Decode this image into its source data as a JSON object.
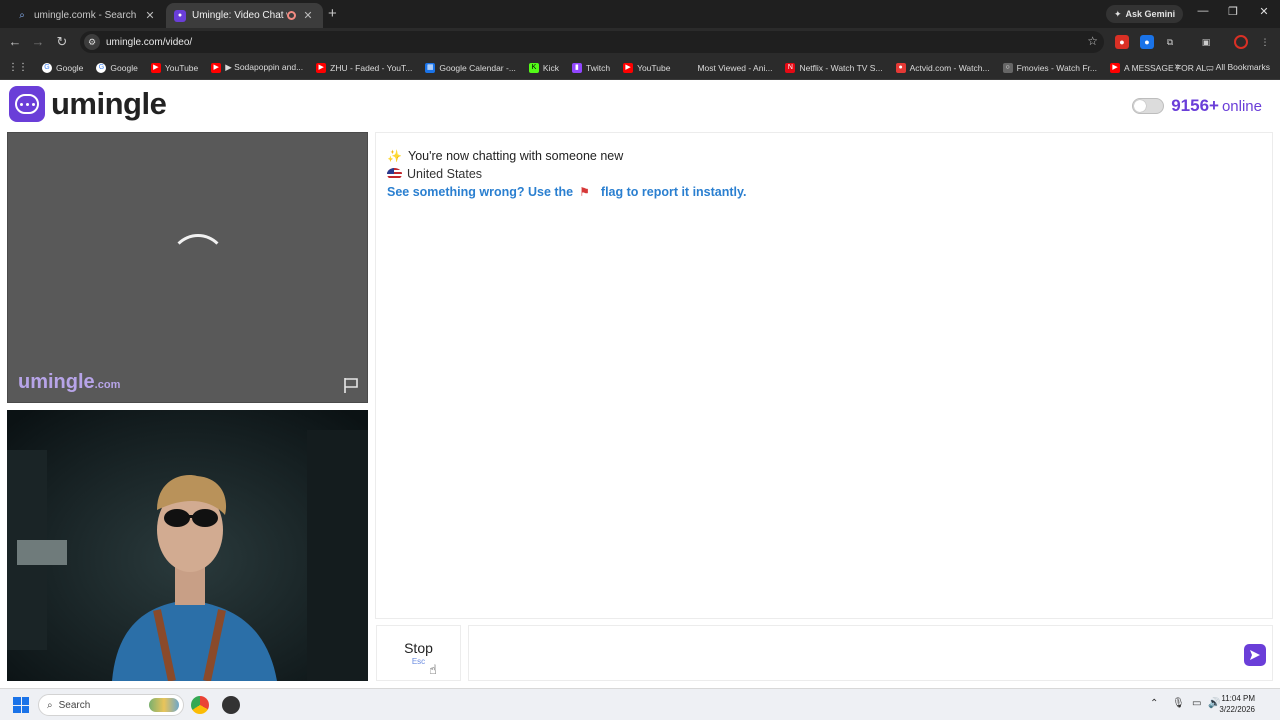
{
  "browser": {
    "tabs": [
      {
        "title": "umingle.comk - Search",
        "icon": "search-icon"
      },
      {
        "title": "Umingle: Video Chat with S",
        "icon": "umingle-icon",
        "active": true
      }
    ],
    "ask_gemini": "Ask Gemini",
    "url": "umingle.com/video/",
    "bookmarks": [
      {
        "label": "Google",
        "color": "#4285f4"
      },
      {
        "label": "Google",
        "color": "#4285f4"
      },
      {
        "label": "YouTube",
        "color": "#ff0000"
      },
      {
        "label": "▶ Sodapoppin and...",
        "color": "#ff0000"
      },
      {
        "label": "ZHU - Faded - YouT...",
        "color": "#ff0000"
      },
      {
        "label": "Google Calendar -...",
        "color": "#1a73e8"
      },
      {
        "label": "Kick",
        "color": "#53fc18"
      },
      {
        "label": "Twitch",
        "color": "#9146ff"
      },
      {
        "label": "YouTube",
        "color": "#ff0000"
      },
      {
        "label": "Most Viewed - Ani...",
        "color": "#2b2b2b"
      },
      {
        "label": "Netflix - Watch TV S...",
        "color": "#e50914"
      },
      {
        "label": "Actvid.com - Watch...",
        "color": "#e53935"
      },
      {
        "label": "Fmovies - Watch Fr...",
        "color": "#888888"
      },
      {
        "label": "A MESSAGE FOR AL...",
        "color": "#ff0000"
      }
    ],
    "all_bookmarks": "All Bookmarks"
  },
  "header": {
    "brand": "umingle",
    "online_count": "9156+",
    "online_label": "online"
  },
  "video": {
    "watermark": "umingle",
    "watermark_domain": ".com"
  },
  "chat": {
    "intro": "You're now chatting with someone new",
    "country": "United States",
    "report_prefix": "See something wrong? Use the",
    "report_suffix": "flag to report it instantly."
  },
  "controls": {
    "stop_label": "Stop",
    "stop_hint": "Esc",
    "message_placeholder": ""
  },
  "taskbar": {
    "search_label": "Search",
    "time": "11:04 PM",
    "date": "3/22/2026"
  },
  "colors": {
    "brand": "#6a3ed8",
    "link": "#2a7fd0"
  }
}
